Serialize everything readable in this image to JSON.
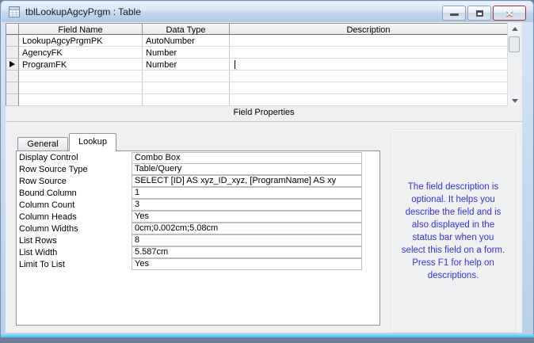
{
  "window": {
    "title": "tblLookupAgcyPrgm : Table",
    "controls": {
      "minimize_icon": "minimize-icon",
      "restore_icon": "restore-icon",
      "close_icon": "close-icon",
      "close_glyph": "✕"
    },
    "accent_colors": {
      "titlebar_blue": "#b2c9e7",
      "close_red": "#d05a44",
      "border_cyan": "#3ec4ec"
    }
  },
  "grid": {
    "columns": [
      "Field Name",
      "Data Type",
      "Description"
    ],
    "rows": [
      {
        "field": "LookupAgcyPrgmPK",
        "type": "AutoNumber",
        "description": ""
      },
      {
        "field": "AgencyFK",
        "type": "Number",
        "description": ""
      },
      {
        "field": "ProgramFK",
        "type": "Number",
        "description": "",
        "selected": true
      }
    ],
    "empty_rows": 3
  },
  "field_properties": {
    "section_label": "Field Properties",
    "tabs": [
      {
        "label": "General",
        "active": false
      },
      {
        "label": "Lookup",
        "active": true
      }
    ],
    "properties": [
      {
        "name": "Display Control",
        "value": "Combo Box"
      },
      {
        "name": "Row Source Type",
        "value": "Table/Query"
      },
      {
        "name": "Row Source",
        "value": "SELECT [ID] AS xyz_ID_xyz, [ProgramName] AS xy"
      },
      {
        "name": "Bound Column",
        "value": "1"
      },
      {
        "name": "Column Count",
        "value": "3"
      },
      {
        "name": "Column Heads",
        "value": "Yes"
      },
      {
        "name": "Column Widths",
        "value": "0cm;0.002cm;5.08cm"
      },
      {
        "name": "List Rows",
        "value": "8"
      },
      {
        "name": "List Width",
        "value": "5.587cm"
      },
      {
        "name": "Limit To List",
        "value": "Yes"
      }
    ],
    "help_text": "The field description is\noptional.  It helps you\ndescribe the field and is\nalso displayed in the\nstatus bar when you\nselect this field on a form.\nPress F1 for help on\ndescriptions.",
    "help_text_color": "#3434d6"
  }
}
